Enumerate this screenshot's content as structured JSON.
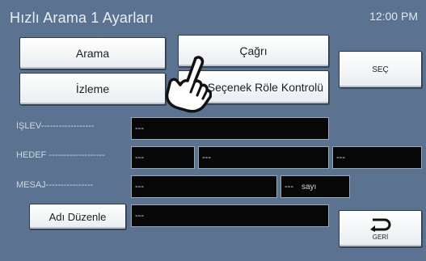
{
  "header": {
    "title": "Hızlı Arama 1 Ayarları",
    "time": "12:00 PM"
  },
  "buttons": {
    "arama": "Arama",
    "cagri": "Çağrı",
    "izleme": "İzleme",
    "relay": "Seçenek Röle Kontrolü",
    "sec": "SEÇ",
    "edit_name": "Adı Düzenle",
    "back": "GERİ"
  },
  "form": {
    "islev_label": "İŞLEV------------------",
    "islev_value": "---",
    "hedef_label": "HEDEF -------------------",
    "hedef_values": [
      "---",
      "---",
      "---"
    ],
    "mesaj_label": "MESAJ----------------",
    "mesaj_value": "---",
    "mesaj_count_value": "---",
    "mesaj_count_unit": "sayı",
    "name_value": "---"
  },
  "icons": {
    "pointer": "hand-pointer-icon",
    "back": "return-arrow-icon"
  }
}
